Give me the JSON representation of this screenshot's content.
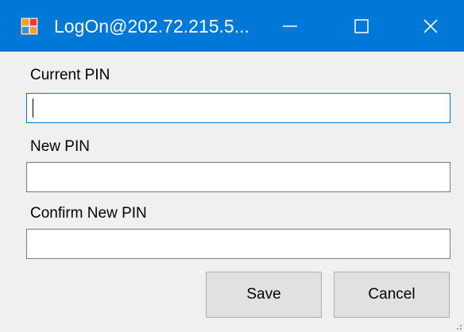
{
  "window": {
    "title": "LogOn@202.72.215.5...",
    "accent_color": "#0078d7",
    "controls": {
      "minimize_icon": "minimize-icon",
      "maximize_icon": "maximize-icon",
      "close_icon": "close-icon"
    }
  },
  "form": {
    "current_pin": {
      "label": "Current PIN",
      "value": ""
    },
    "new_pin": {
      "label": "New PIN",
      "value": ""
    },
    "confirm_pin": {
      "label": "Confirm New PIN",
      "value": ""
    }
  },
  "buttons": {
    "save_label": "Save",
    "cancel_label": "Cancel"
  }
}
